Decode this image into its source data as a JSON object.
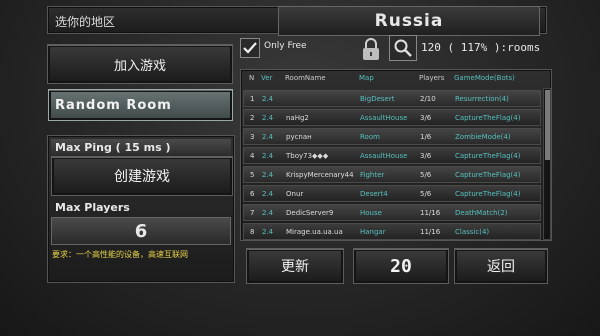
{
  "region": {
    "label": "选你的地区",
    "value": "Russia"
  },
  "left": {
    "join_label": "加入游戏",
    "random_room": "Random Room",
    "max_ping": "Max Ping ( 15 ms )",
    "create_label": "创建游戏",
    "max_players_label": "Max Players",
    "max_players_value": "6",
    "requirement": "要求：一个高性能的设备，高速互联网"
  },
  "filter": {
    "only_free": "Only Free",
    "only_free_checked": true,
    "rooms_count": "120 ( 117% ):rooms"
  },
  "table": {
    "headers": [
      "N",
      "Ver",
      "RoomName",
      "Map",
      "Players",
      "GameMode(Bots)"
    ],
    "rows": [
      [
        "1",
        "2.4",
        "",
        "BigDesert",
        "2/10",
        "Resurrection(4)"
      ],
      [
        "2",
        "2.4",
        "naHg2",
        "AssaultHouse",
        "3/6",
        "CaptureTheFlag(4)"
      ],
      [
        "3",
        "2.4",
        "русnaн",
        "Room",
        "1/6",
        "ZombieMode(4)"
      ],
      [
        "4",
        "2.4",
        "Tboy73◆◆◆",
        "AssaultHouse",
        "3/6",
        "CaptureTheFlag(4)"
      ],
      [
        "5",
        "2.4",
        "KrispyMercenary44",
        "Fighter",
        "5/6",
        "CaptureTheFlag(4)"
      ],
      [
        "6",
        "2.4",
        "Onur",
        "Desert4",
        "5/6",
        "CaptureTheFlag(4)"
      ],
      [
        "7",
        "2.4",
        "DedicServer9",
        "House",
        "11/16",
        "DeathMatch(2)"
      ],
      [
        "8",
        "2.4",
        "Mirage.ua.ua.ua",
        "Hangar",
        "11/16",
        "Classic(4)"
      ]
    ]
  },
  "bottom": {
    "refresh": "更新",
    "page": "20",
    "back": "返回"
  },
  "colors": {
    "accent_teal": "#57c0c0",
    "requirement_yellow": "#e6d34a"
  }
}
